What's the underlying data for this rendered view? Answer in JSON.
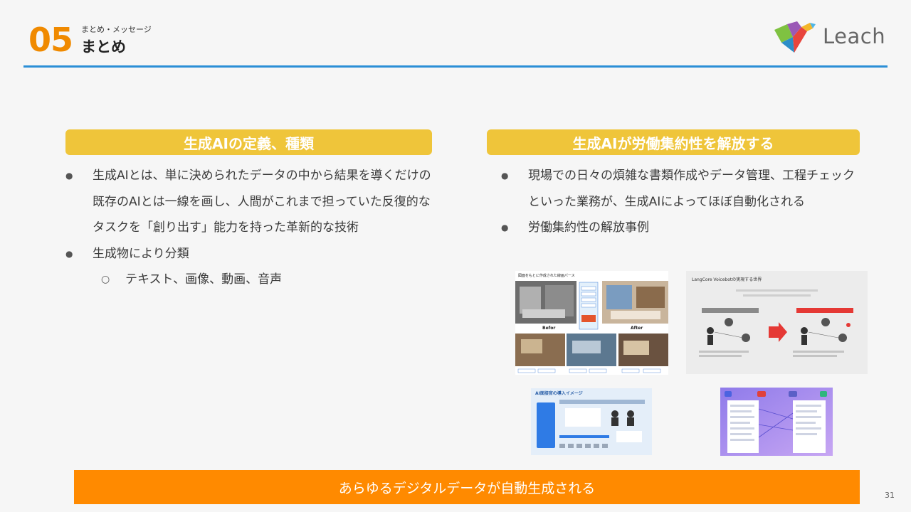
{
  "header": {
    "section_number": "05",
    "section_subtitle": "まとめ・メッセージ",
    "section_title": "まとめ",
    "logo_text": "Leach",
    "accent_color": "#f08a00",
    "rule_color": "#2b8fd6"
  },
  "left": {
    "heading": "生成AIの定義、種類",
    "bullets": [
      "生成AIとは、単に決められたデータの中から結果を導くだけの既存のAIとは一線を画し、人間がこれまで担っていた反復的なタスクを「創り出す」能力を持った革新的な技術",
      "生成物により分類"
    ],
    "sub_bullets": [
      "テキスト、画像、動画、音声"
    ]
  },
  "right": {
    "heading": "生成AIが労働集約性を解放する",
    "bullets": [
      "現場での日々の煩雑な書類作成やデータ管理、工程チェックといった業務が、生成AIによってほぼ自動化される",
      "労働集約性の解放事例"
    ],
    "examples": {
      "interior": {
        "caption": "図面をもとに作成された線画パース",
        "label_before": "Befor",
        "label_after": "After"
      },
      "voicebot": {
        "title": "LangCore Voicebotの実現する世界"
      },
      "ai_interview": {
        "title": "AI面接官の導入イメージ"
      }
    }
  },
  "banner": {
    "text": "あらゆるデジタルデータが自動生成される",
    "color": "#ff8a00"
  },
  "footer": {
    "page_number": "31"
  }
}
